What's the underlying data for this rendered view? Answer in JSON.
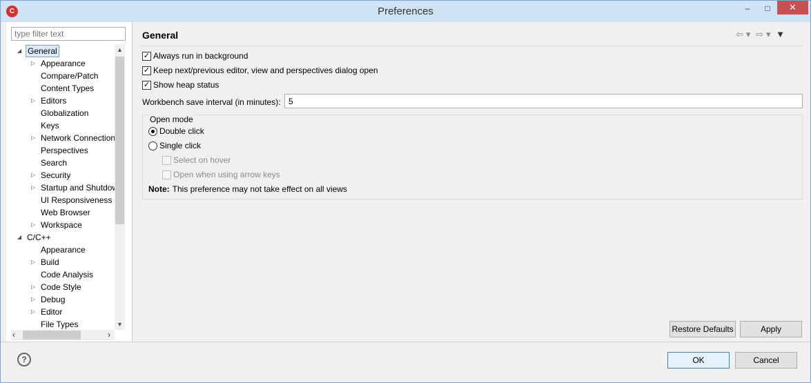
{
  "window": {
    "title": "Preferences",
    "app_icon_glyph": "C",
    "minimize_glyph": "–",
    "maximize_glyph": "□",
    "close_glyph": "✕"
  },
  "sidebar": {
    "filter_placeholder": "type filter text",
    "tree": [
      {
        "label": "General",
        "arrow": "◢",
        "selected": true
      },
      {
        "label": "Appearance",
        "arrow": "▷"
      },
      {
        "label": "Compare/Patch",
        "arrow": ""
      },
      {
        "label": "Content Types",
        "arrow": ""
      },
      {
        "label": "Editors",
        "arrow": "▷"
      },
      {
        "label": "Globalization",
        "arrow": ""
      },
      {
        "label": "Keys",
        "arrow": ""
      },
      {
        "label": "Network Connection",
        "arrow": "▷"
      },
      {
        "label": "Perspectives",
        "arrow": ""
      },
      {
        "label": "Search",
        "arrow": ""
      },
      {
        "label": "Security",
        "arrow": "▷"
      },
      {
        "label": "Startup and Shutdow",
        "arrow": "▷"
      },
      {
        "label": "UI Responsiveness M",
        "arrow": ""
      },
      {
        "label": "Web Browser",
        "arrow": ""
      },
      {
        "label": "Workspace",
        "arrow": "▷"
      },
      {
        "label": "C/C++",
        "arrow": "◢"
      },
      {
        "label": "Appearance",
        "arrow": ""
      },
      {
        "label": "Build",
        "arrow": "▷"
      },
      {
        "label": "Code Analysis",
        "arrow": ""
      },
      {
        "label": "Code Style",
        "arrow": "▷"
      },
      {
        "label": "Debug",
        "arrow": "▷"
      },
      {
        "label": "Editor",
        "arrow": "▷"
      },
      {
        "label": "File Types",
        "arrow": ""
      }
    ]
  },
  "main": {
    "page_title": "General",
    "nav": {
      "back": "⇦",
      "back_menu": "▾",
      "forward": "⇨",
      "forward_menu": "▾",
      "view_menu": "▼"
    },
    "checkboxes": [
      {
        "label": "Always run in background",
        "checked": true
      },
      {
        "label": "Keep next/previous editor, view and perspectives dialog open",
        "checked": true
      },
      {
        "label": "Show heap status",
        "checked": true
      }
    ],
    "save_interval_label": "Workbench save interval (in minutes):",
    "save_interval_value": "5",
    "open_mode": {
      "title": "Open mode",
      "double_click": "Double click",
      "single_click": "Single click",
      "selected": "double_click",
      "select_on_hover": "Select on hover",
      "open_arrow_keys": "Open when using arrow keys",
      "note_label": "Note:",
      "note_text": "This preference may not take effect on all views"
    },
    "restore_defaults": "Restore Defaults",
    "apply": "Apply"
  },
  "footer": {
    "help_glyph": "?",
    "ok": "OK",
    "cancel": "Cancel"
  }
}
